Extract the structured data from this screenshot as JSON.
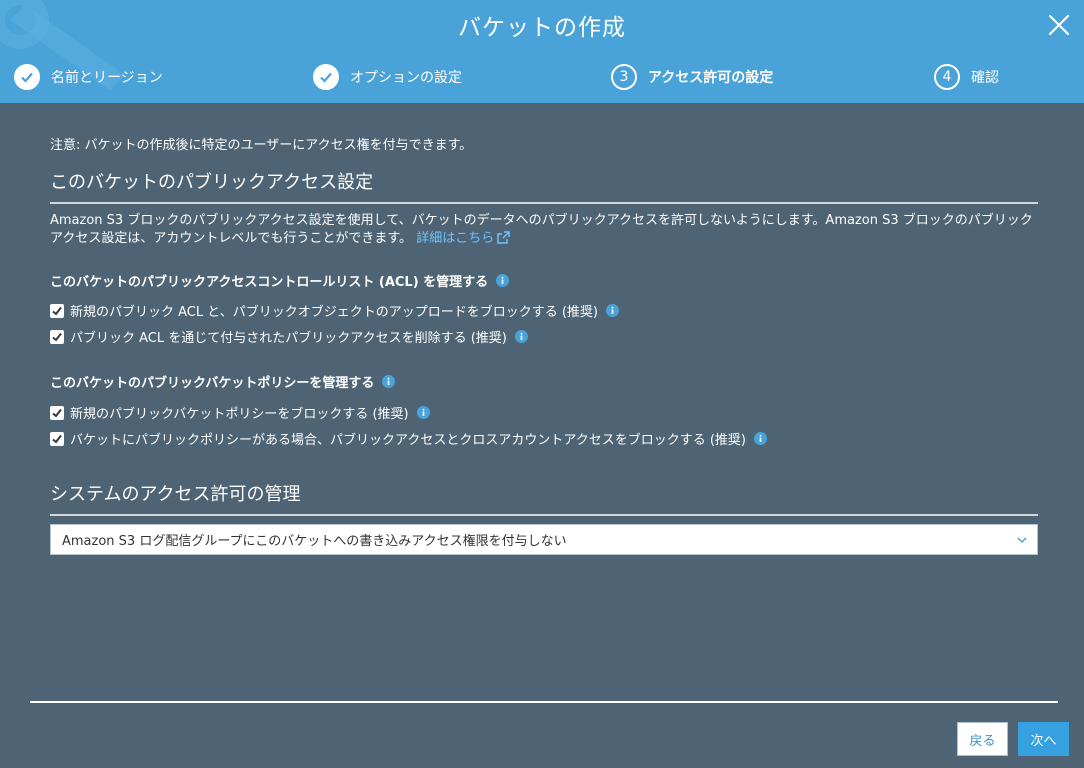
{
  "header": {
    "title": "バケットの作成",
    "steps": [
      {
        "number": "1",
        "label": "名前とリージョン",
        "state": "done"
      },
      {
        "number": "2",
        "label": "オプションの設定",
        "state": "done"
      },
      {
        "number": "3",
        "label": "アクセス許可の設定",
        "state": "active"
      },
      {
        "number": "4",
        "label": "確認",
        "state": "pending"
      }
    ]
  },
  "main": {
    "note": "注意: バケットの作成後に特定のユーザーにアクセス権を付与できます。",
    "public_access": {
      "title": "このバケットのパブリックアクセス設定",
      "description": "Amazon S3 ブロックのパブリックアクセス設定を使用して、バケットのデータへのパブリックアクセスを許可しないようにします。Amazon S3 ブロックのパブリックアクセス設定は、アカウントレベルでも行うことができます。",
      "learn_more": "詳細はこちら",
      "acl_heading": "このバケットのパブリックアクセスコントロールリスト (ACL) を管理する",
      "acl_options": [
        {
          "label": "新規のパブリック ACL と、パブリックオブジェクトのアップロードをブロックする (推奨)",
          "checked": true
        },
        {
          "label": "パブリック ACL を通じて付与されたパブリックアクセスを削除する (推奨)",
          "checked": true
        }
      ],
      "policy_heading": "このバケットのパブリックバケットポリシーを管理する",
      "policy_options": [
        {
          "label": "新規のパブリックバケットポリシーをブロックする (推奨)",
          "checked": true
        },
        {
          "label": "バケットにパブリックポリシーがある場合、パブリックアクセスとクロスアカウントアクセスをブロックする (推奨)",
          "checked": true
        }
      ]
    },
    "system_permissions": {
      "title": "システムのアクセス許可の管理",
      "selected": "Amazon S3 ログ配信グループにこのバケットへの書き込みアクセス権限を付与しない"
    }
  },
  "footer": {
    "back_label": "戻る",
    "next_label": "次へ"
  },
  "colors": {
    "header_bg": "#4aa3d8",
    "content_bg": "#4e6474",
    "link": "#6cc3ff",
    "primary_button": "#35a1e0"
  }
}
